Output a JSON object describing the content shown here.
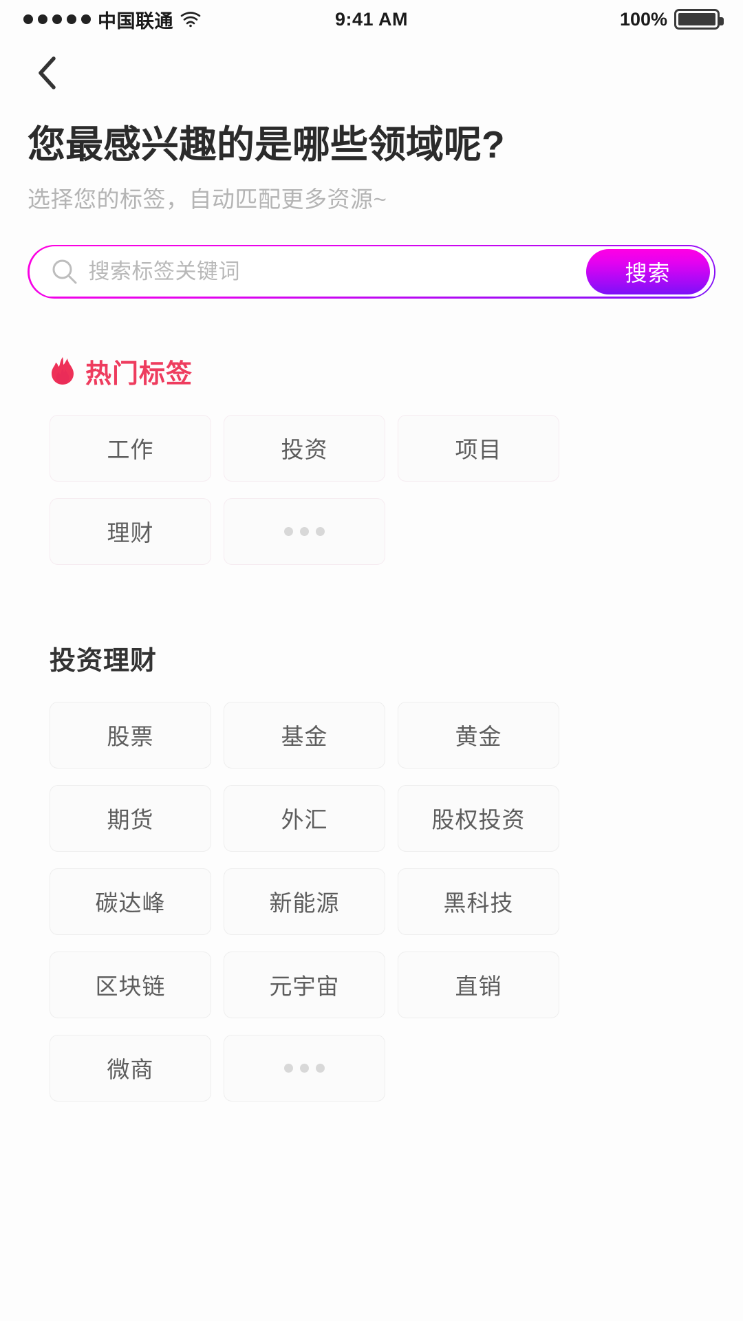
{
  "statusbar": {
    "carrier": "中国联通",
    "time": "9:41 AM",
    "battery_pct": "100%",
    "wifi_icon": "wifi-icon",
    "battery_icon": "battery-full-icon",
    "signal_icon": "signal-dots-icon"
  },
  "nav": {
    "back_icon": "chevron-left-icon"
  },
  "header": {
    "title": "您最感兴趣的是哪些领域呢?",
    "subtitle": "选择您的标签，自动匹配更多资源~"
  },
  "search": {
    "placeholder": "搜索标签关键词",
    "value": "",
    "button_label": "搜索",
    "icon": "search-icon",
    "border_gradient_from": "#ff00e4",
    "border_gradient_to": "#7d11f8",
    "button_gradient_from": "#ff00e4",
    "button_gradient_to": "#7d11f8"
  },
  "hot_section": {
    "title": "热门标签",
    "icon": "flame-icon",
    "title_color": "#ee3c5e",
    "tags": [
      {
        "label": "工作"
      },
      {
        "label": "投资"
      },
      {
        "label": "项目"
      },
      {
        "label": "理财"
      },
      {
        "label": "•••",
        "is_more": true
      }
    ]
  },
  "category_section": {
    "title": "投资理财",
    "tags": [
      {
        "label": "股票"
      },
      {
        "label": "基金"
      },
      {
        "label": "黄金"
      },
      {
        "label": "期货"
      },
      {
        "label": "外汇"
      },
      {
        "label": "股权投资"
      },
      {
        "label": "碳达峰"
      },
      {
        "label": "新能源"
      },
      {
        "label": "黑科技"
      },
      {
        "label": "区块链"
      },
      {
        "label": "元宇宙"
      },
      {
        "label": "直销"
      },
      {
        "label": "微商"
      },
      {
        "label": "•••",
        "is_more": true
      }
    ]
  }
}
